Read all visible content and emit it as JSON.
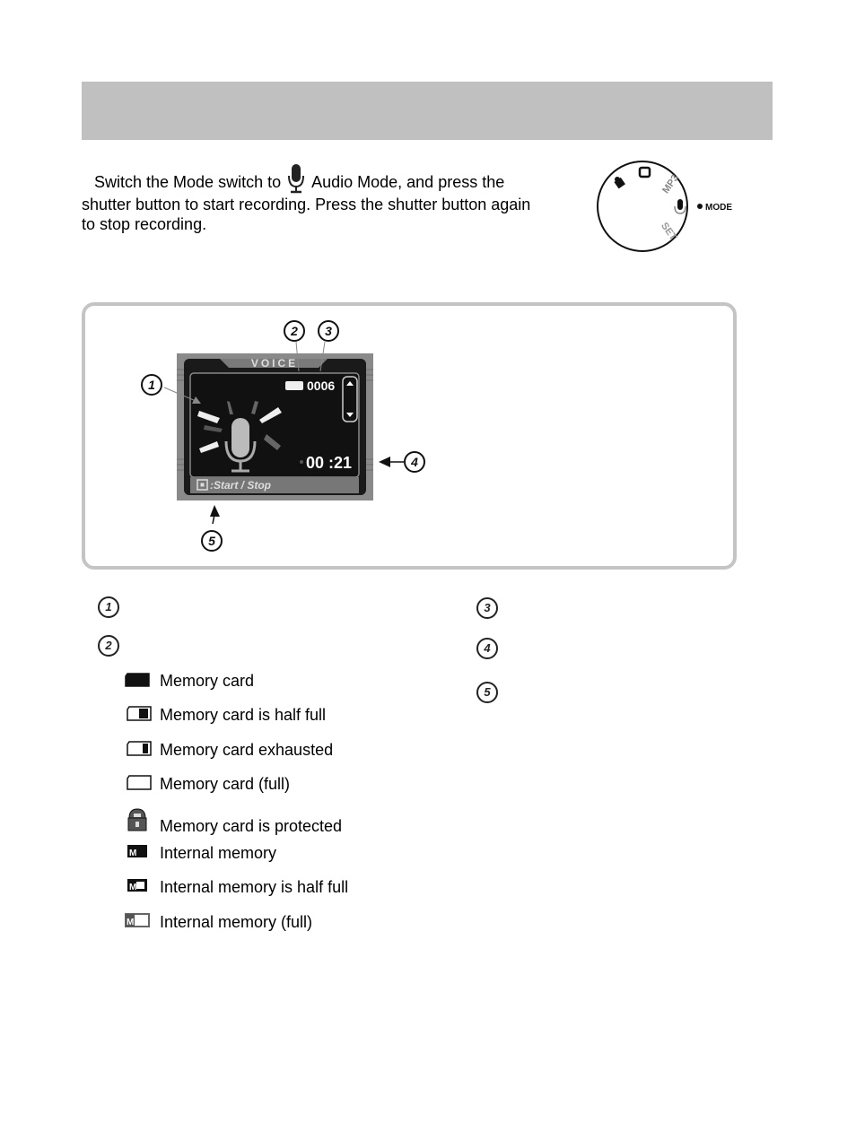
{
  "header": {
    "title": ""
  },
  "intro": {
    "line1_before_icon": "Switch the Mode switch to",
    "icon": "microphone-icon",
    "line1_after_icon": "Audio Mode, and press the",
    "line2": "shutter button to start recording. Press the shutter button again",
    "line3": "to stop recording."
  },
  "mode_dial": {
    "positions": [
      "movie",
      "camera",
      "MP3",
      "audio",
      "SET"
    ],
    "mp3_label": "MP3",
    "set_label": "SET",
    "mode_label": "MODE"
  },
  "screen": {
    "title": "VOICE",
    "counter": "0006",
    "time": "00 :21",
    "hint": ":Start / Stop",
    "callouts": [
      "1",
      "2",
      "3",
      "4",
      "5"
    ]
  },
  "legend": {
    "numbers": [
      "1",
      "2",
      "3",
      "4",
      "5"
    ],
    "memory_items": [
      {
        "icon": "memory-card-icon",
        "label": "Memory card"
      },
      {
        "icon": "memory-card-half-icon",
        "label": "Memory card is half full"
      },
      {
        "icon": "memory-card-exhausted-icon",
        "label": "Memory card exhausted"
      },
      {
        "icon": "memory-card-full-icon",
        "label": "Memory card (full)"
      },
      {
        "icon": "lock-icon",
        "label": "Memory card is protected"
      },
      {
        "icon": "internal-memory-icon",
        "label": "Internal memory"
      },
      {
        "icon": "internal-memory-half-icon",
        "label": "Internal memory is half full"
      },
      {
        "icon": "internal-memory-full-icon",
        "label": "Internal memory (full)"
      }
    ]
  },
  "colors": {
    "header_bar": "#c0c0c0",
    "panel_border": "#c4c4c4"
  }
}
